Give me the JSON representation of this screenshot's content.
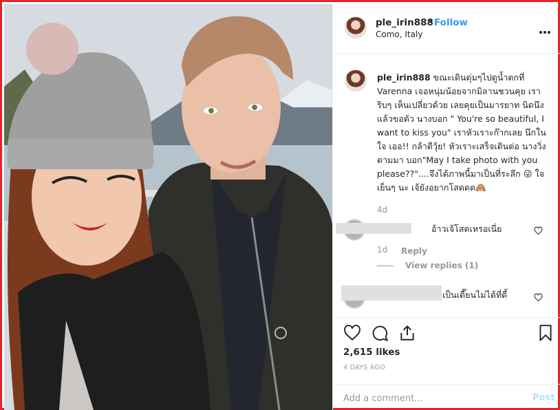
{
  "header": {
    "username": "ple_irin888",
    "dot": "•",
    "follow_label": "Follow",
    "location": "Como, Italy"
  },
  "caption": {
    "username": "ple_irin888",
    "text": "ขณะเดินดุ่มๆไปดูน้ำตกที่ Varenna เจอหนุ่มน้อยจากมิลานชวนคุย เราริบๆ เห็นเปลี่ยวด้วย เลยคุยเป็นมารยาท นิดนึง แล้วขอตัว นางบอก \" You're so beautiful, I want to kiss you\" เราหัวเราะก๊ากเลย นึกในใจ เออ!! กล้าดีวุ้ย! หัวเราะเสร็จเดินต่อ นางวิ่งตามมา บอก\"May I take photo with you please??\"....จึงได้ภาพนี้มาเป็นที่ระลึก 😜 ใจเย็นๆ นะ เจ้ยังอยากโสดดด🙈",
    "time": "4d"
  },
  "comments": [
    {
      "text": "อ้าวเจ้โสดเหรอเนี่ย",
      "time": "1d",
      "reply_label": "Reply",
      "view_replies_label": "View replies (1)"
    },
    {
      "text": "เป็นเดี๊ยนไม่ได้ที่ดี้"
    }
  ],
  "actions": {
    "likes": "2,615 likes",
    "age": "4 DAYS AGO"
  },
  "add_comment": {
    "placeholder": "Add a comment...",
    "post_label": "Post"
  },
  "colors": {
    "frame": "#e3262b",
    "follow": "#3897f0",
    "post_disabled": "#b2dffc",
    "muted": "#999999"
  }
}
